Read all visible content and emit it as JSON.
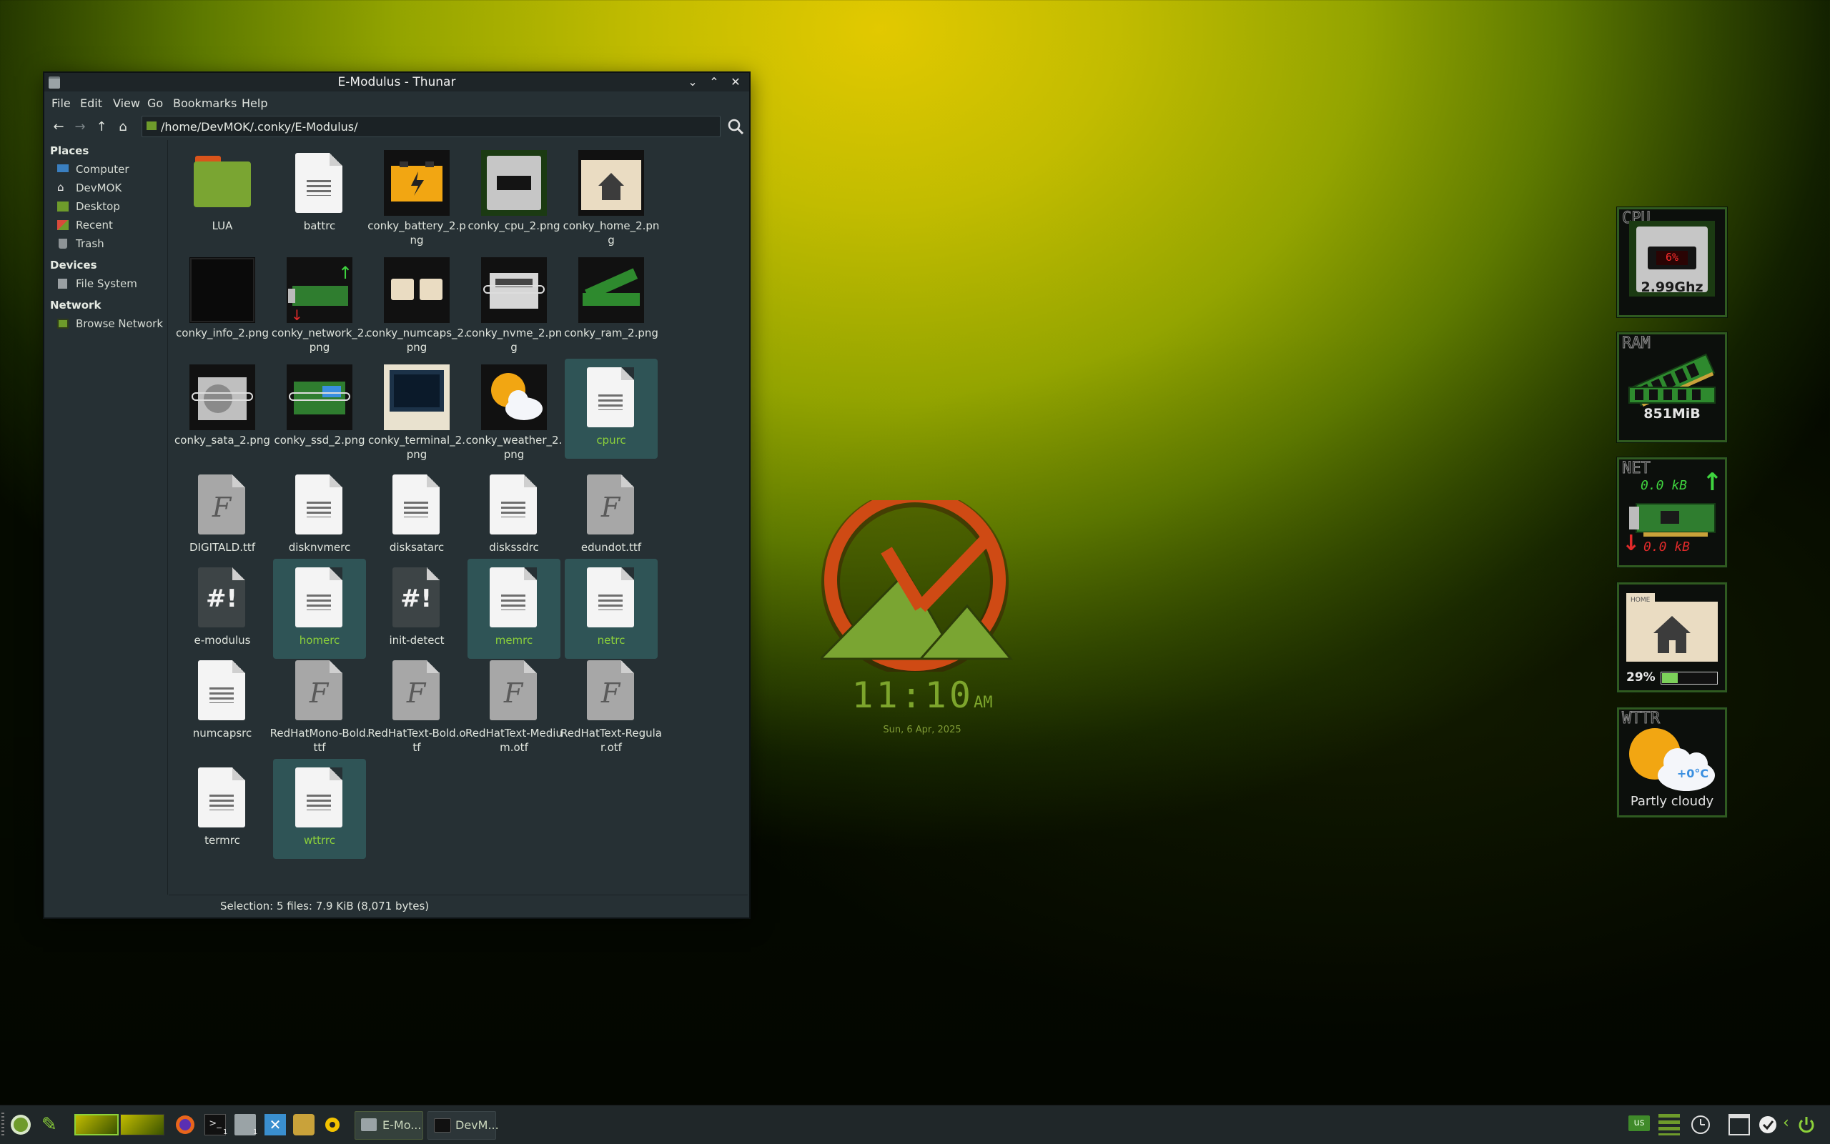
{
  "window": {
    "title": "E-Modulus - Thunar",
    "controls": {
      "minimize": "⌄",
      "maximize": "⌃",
      "close": "✕"
    }
  },
  "menubar": [
    "File",
    "Edit",
    "View",
    "Go",
    "Bookmarks",
    "Help"
  ],
  "location": {
    "path": "/home/DevMOK/.conky/E-Modulus/"
  },
  "sidebar": {
    "places_header": "Places",
    "places": [
      "Computer",
      "DevMOK",
      "Desktop",
      "Recent",
      "Trash"
    ],
    "devices_header": "Devices",
    "devices": [
      "File System"
    ],
    "network_header": "Network",
    "network": [
      "Browse Network"
    ]
  },
  "files": [
    {
      "name": "LUA",
      "kind": "folder",
      "selected": false
    },
    {
      "name": "battrc",
      "kind": "text",
      "selected": false
    },
    {
      "name": "conky_battery_2.png",
      "kind": "battery",
      "selected": false
    },
    {
      "name": "conky_cpu_2.png",
      "kind": "cpu",
      "selected": false
    },
    {
      "name": "conky_home_2.png",
      "kind": "home",
      "selected": false
    },
    {
      "name": "conky_info_2.png",
      "kind": "info",
      "selected": false
    },
    {
      "name": "conky_network_2.png",
      "kind": "network",
      "selected": false
    },
    {
      "name": "conky_numcaps_2.png",
      "kind": "numcaps",
      "selected": false
    },
    {
      "name": "conky_nvme_2.png",
      "kind": "nvme",
      "selected": false
    },
    {
      "name": "conky_ram_2.png",
      "kind": "ram",
      "selected": false
    },
    {
      "name": "conky_sata_2.png",
      "kind": "sata",
      "selected": false
    },
    {
      "name": "conky_ssd_2.png",
      "kind": "ssd",
      "selected": false
    },
    {
      "name": "conky_terminal_2.png",
      "kind": "terminal",
      "selected": false
    },
    {
      "name": "conky_weather_2.png",
      "kind": "weather",
      "selected": false
    },
    {
      "name": "cpurc",
      "kind": "text",
      "selected": true
    },
    {
      "name": "DIGITALD.ttf",
      "kind": "font",
      "selected": false
    },
    {
      "name": "disknvmerc",
      "kind": "text",
      "selected": false
    },
    {
      "name": "disksatarc",
      "kind": "text",
      "selected": false
    },
    {
      "name": "diskssdrc",
      "kind": "text",
      "selected": false
    },
    {
      "name": "edundot.ttf",
      "kind": "font",
      "selected": false
    },
    {
      "name": "e-modulus",
      "kind": "script",
      "selected": false
    },
    {
      "name": "homerc",
      "kind": "text",
      "selected": true
    },
    {
      "name": "init-detect",
      "kind": "script",
      "selected": false
    },
    {
      "name": "memrc",
      "kind": "text",
      "selected": true
    },
    {
      "name": "netrc",
      "kind": "text",
      "selected": true
    },
    {
      "name": "numcapsrc",
      "kind": "text",
      "selected": false
    },
    {
      "name": "RedHatMono-Bold.ttf",
      "kind": "font",
      "selected": false
    },
    {
      "name": "RedHatText-Bold.otf",
      "kind": "font",
      "selected": false
    },
    {
      "name": "RedHatText-Medium.otf",
      "kind": "font",
      "selected": false
    },
    {
      "name": "RedHatText-Regular.otf",
      "kind": "font",
      "selected": false
    },
    {
      "name": "termrc",
      "kind": "text",
      "selected": false
    },
    {
      "name": "wttrrc",
      "kind": "text",
      "selected": true
    }
  ],
  "status": "Selection: 5 files: 7.9 KiB (8,071 bytes)",
  "clock": {
    "time": "11:10",
    "ampm": "AM",
    "date": "Sun, 6 Apr, 2025"
  },
  "widgets": {
    "cpu": {
      "label": "CPU",
      "value": "2.99Ghz",
      "lcd": "6%"
    },
    "ram": {
      "label": "RAM",
      "value": "851MiB"
    },
    "net": {
      "label": "NET",
      "up": "0.0 kB",
      "down": "0.0 kB"
    },
    "home": {
      "label": "HOME",
      "value": "29%",
      "level": 0.29
    },
    "weather": {
      "label": "WTTR",
      "temp": "+0°C",
      "value": "Partly cloudy"
    }
  },
  "taskbar": {
    "tasks": [
      {
        "label": "E-Mo..."
      },
      {
        "label": "DevM..."
      }
    ],
    "terminal_badge": "1",
    "files_badge": "1",
    "keyboard": "us"
  },
  "colors": {
    "accent": "#8cd13a",
    "selection": "#2f5456",
    "window_bg": "#263034"
  }
}
